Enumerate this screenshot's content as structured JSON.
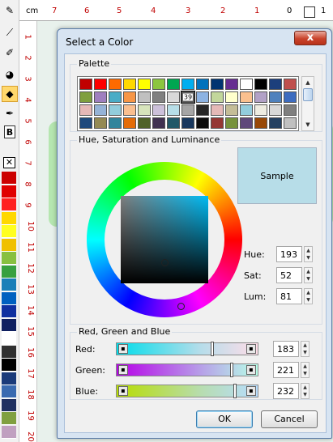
{
  "ruler": {
    "unit": "cm",
    "top_marks": [
      "7",
      "6",
      "5",
      "4",
      "3",
      "2",
      "1",
      "0",
      "1"
    ],
    "left_marks": [
      "1",
      "2",
      "3",
      "4",
      "5",
      "6",
      "7",
      "8",
      "9",
      "10",
      "11",
      "12",
      "13",
      "14",
      "15",
      "16",
      "17",
      "18",
      "19",
      "20"
    ]
  },
  "toolbar": {
    "text_tool_label": "B",
    "color_column": [
      "#cc0000",
      "#e00000",
      "#ff2020",
      "#ffd800",
      "#ffff20",
      "#f0c000",
      "#88c040",
      "#38a040",
      "#1a7fb8",
      "#0060c0",
      "#1030a0",
      "#102060",
      "#ffffff",
      "#303030",
      "#000000",
      "#1a3a7a",
      "#3a6ab0",
      "#203060",
      "#80a040",
      "#c0a0c0"
    ]
  },
  "dialog": {
    "title": "Select a Color",
    "close_label": "x",
    "palette": {
      "title": "Palette",
      "selected_index_label": "39",
      "colors": [
        "#c00000",
        "#ff0000",
        "#ff6a00",
        "#ffd800",
        "#ffff00",
        "#8cc63f",
        "#00a651",
        "#00aeef",
        "#0072bc",
        "#003471",
        "#662d91",
        "#ffffff",
        "#000000",
        "#1c3f7c",
        "#c0504d",
        "#7f9f3f",
        "#9f7fbf",
        "#4aacc6",
        "#f79646",
        "#c0c0c0",
        "#808080",
        "#d9d9d9",
        "#595959",
        "#8db3e2",
        "#c2d69b",
        "#ffffcc",
        "#fac08f",
        "#b2a1c7",
        "#4f81bd",
        "#3d6cc0",
        "#e6b8b7",
        "#95b3d7",
        "#92cddc",
        "#fabf8f",
        "#d7e4bc",
        "#ccc0da",
        "#b7dee8",
        "#a5a5a5",
        "#262626",
        "#e5b9b7",
        "#c4bd97",
        "#93cddd",
        "#eeece1",
        "#d8d8d8",
        "#7f7f7f",
        "#1f497d",
        "#948a54",
        "#31859c",
        "#e36c09",
        "#4f6228",
        "#403151",
        "#215868",
        "#17375e",
        "#0c0c0c",
        "#953734",
        "#76923c",
        "#5f497a",
        "#984806",
        "#244061",
        "#c0c0c0"
      ]
    },
    "hsl": {
      "title": "Hue, Saturation and Luminance",
      "sample_label": "Sample",
      "sample_color": "#b7dde8",
      "hue_label": "Hue:",
      "hue_value": "193",
      "sat_label": "Sat:",
      "sat_value": "52",
      "lum_label": "Lum:",
      "lum_value": "81"
    },
    "rgb": {
      "title": "Red, Green and Blue",
      "red_label": "Red:",
      "red_value": "183",
      "green_label": "Green:",
      "green_value": "221",
      "blue_label": "Blue:",
      "blue_value": "232"
    },
    "ok_label": "OK",
    "cancel_label": "Cancel"
  }
}
